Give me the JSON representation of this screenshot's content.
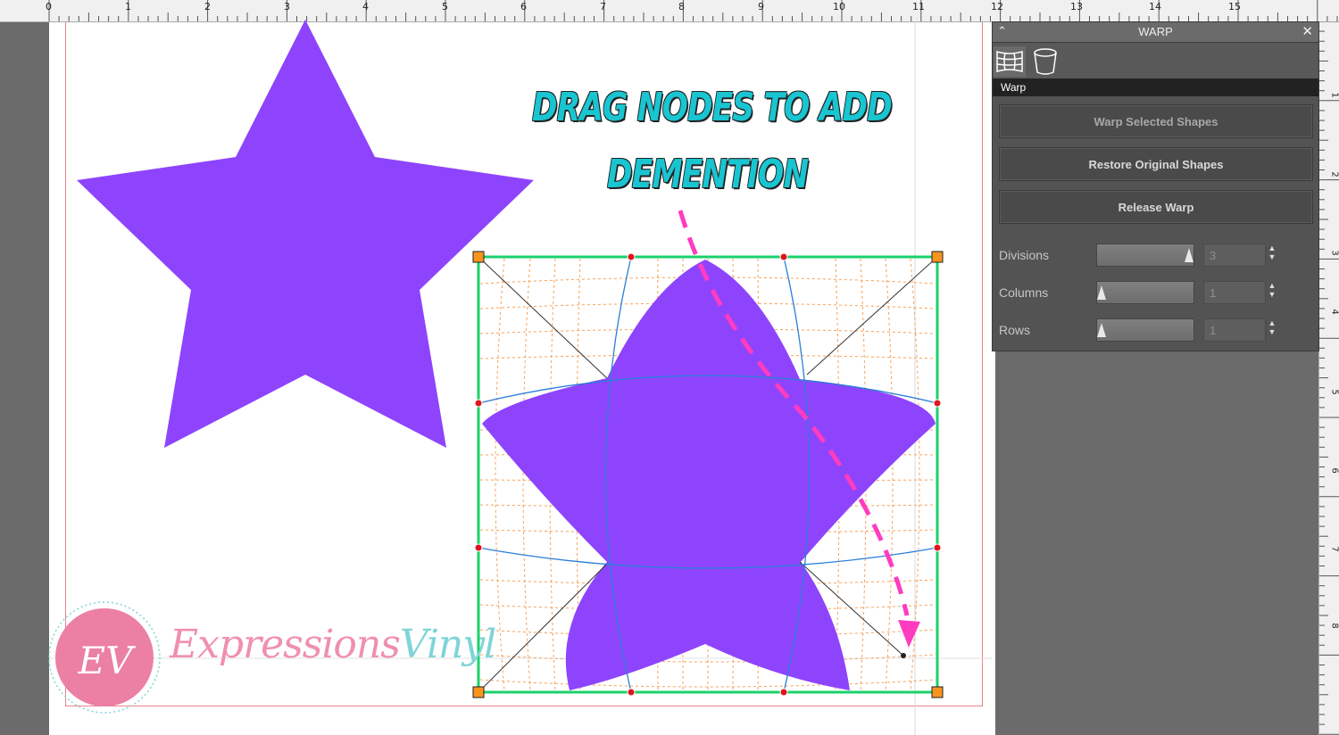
{
  "ruler": {
    "top_labels": [
      "0",
      "1",
      "2",
      "3",
      "4",
      "5",
      "6",
      "7",
      "8",
      "9",
      "10",
      "11",
      "12",
      "13",
      "14",
      "15"
    ],
    "side_labels": [
      "1",
      "2",
      "3",
      "4",
      "5",
      "6",
      "7",
      "8"
    ]
  },
  "annotation": {
    "line1": "DRAG NODES TO ADD",
    "line2": "DEMENTION"
  },
  "logo": {
    "initials": "EV",
    "word1": "Expressions",
    "word2": "Vinyl"
  },
  "panel": {
    "title": "WARP",
    "collapse_icon": "caret-up",
    "close_icon": "close",
    "tabs": [
      {
        "icon": "warp-grid-icon"
      },
      {
        "icon": "bucket-icon"
      }
    ],
    "section": "Warp",
    "buttons": {
      "warp_selected": "Warp Selected Shapes",
      "restore": "Restore Original Shapes",
      "release": "Release Warp"
    },
    "fields": {
      "divisions": {
        "label": "Divisions",
        "value": "3"
      },
      "columns": {
        "label": "Columns",
        "value": "1"
      },
      "rows": {
        "label": "Rows",
        "value": "1"
      }
    }
  },
  "colors": {
    "star": "#8e44fc",
    "arrow": "#ff3cc0",
    "warp_frame": "#1bd16b",
    "grid_curves": "#2a7fd8",
    "orange_grid": "#f5a25b",
    "annotation_text": "#19c5d1"
  }
}
